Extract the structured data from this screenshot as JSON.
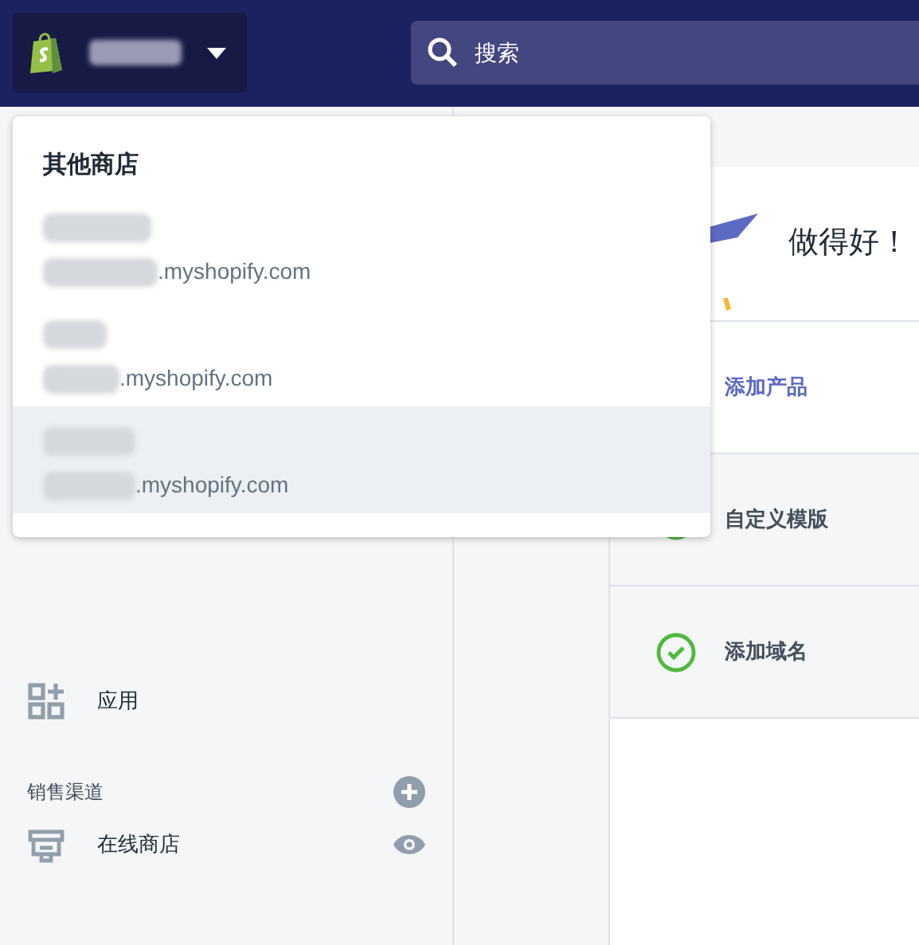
{
  "topbar": {
    "search": {
      "placeholder": "搜索"
    }
  },
  "store_menu": {
    "title": "其他商店",
    "stores": [
      {
        "domain_suffix": ".myshopify.com",
        "selected": false
      },
      {
        "domain_suffix": ".myshopify.com",
        "selected": false
      },
      {
        "domain_suffix": ".myshopify.com",
        "selected": true
      }
    ]
  },
  "sidebar": {
    "items": [
      {
        "label": "应用",
        "kind": "apps"
      }
    ],
    "channels": {
      "title": "销售渠道",
      "items": [
        {
          "label": "在线商店",
          "kind": "store"
        }
      ]
    }
  },
  "setup": {
    "heading": "做得好！",
    "tasks": [
      {
        "label": "添加产品",
        "done": false
      },
      {
        "label": "自定义模版",
        "done": true
      },
      {
        "label": "添加域名",
        "done": true
      }
    ]
  }
}
